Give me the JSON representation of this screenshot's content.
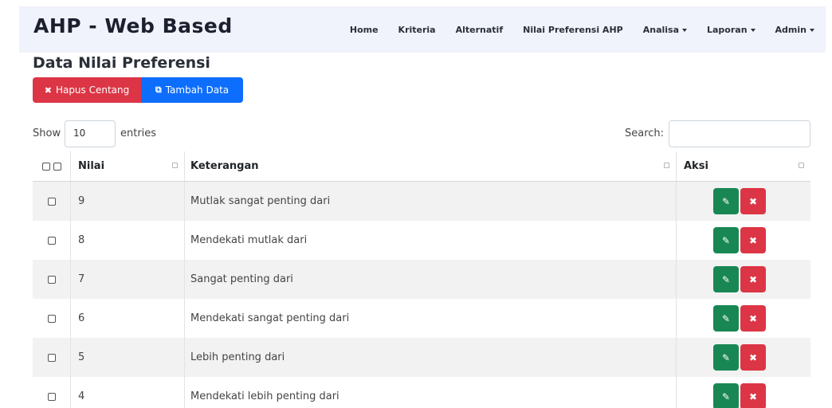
{
  "navbar": {
    "brand": "AHP - Web Based",
    "items": [
      {
        "label": "Home",
        "dropdown": false
      },
      {
        "label": "Kriteria",
        "dropdown": false
      },
      {
        "label": "Alternatif",
        "dropdown": false
      },
      {
        "label": "Nilai Preferensi AHP",
        "dropdown": false
      },
      {
        "label": "Analisa",
        "dropdown": true
      },
      {
        "label": "Laporan",
        "dropdown": true
      },
      {
        "label": "Admin",
        "dropdown": true
      }
    ]
  },
  "page": {
    "title": "Data Nilai Preferensi",
    "delete_checked_label": "Hapus Centang",
    "delete_checked_icon": "✖",
    "add_label": "Tambah Data",
    "add_icon": "⧉"
  },
  "table_controls": {
    "show_label": "Show",
    "entries_value": "10",
    "entries_label": "entries",
    "search_label": "Search:",
    "search_value": ""
  },
  "table": {
    "columns": [
      "Nilai",
      "Keterangan",
      "Aksi"
    ],
    "rows": [
      {
        "nilai": "9",
        "keterangan": "Mutlak sangat penting dari"
      },
      {
        "nilai": "8",
        "keterangan": "Mendekati mutlak dari"
      },
      {
        "nilai": "7",
        "keterangan": "Sangat penting dari"
      },
      {
        "nilai": "6",
        "keterangan": "Mendekati sangat penting dari"
      },
      {
        "nilai": "5",
        "keterangan": "Lebih penting dari"
      },
      {
        "nilai": "4",
        "keterangan": "Mendekati lebih penting dari"
      }
    ],
    "edit_icon": "✎",
    "delete_icon": "✖"
  },
  "colors": {
    "danger": "#dc3545",
    "primary": "#0d6efd",
    "success": "#198754",
    "navbar_bg": "#f0f3fb"
  }
}
